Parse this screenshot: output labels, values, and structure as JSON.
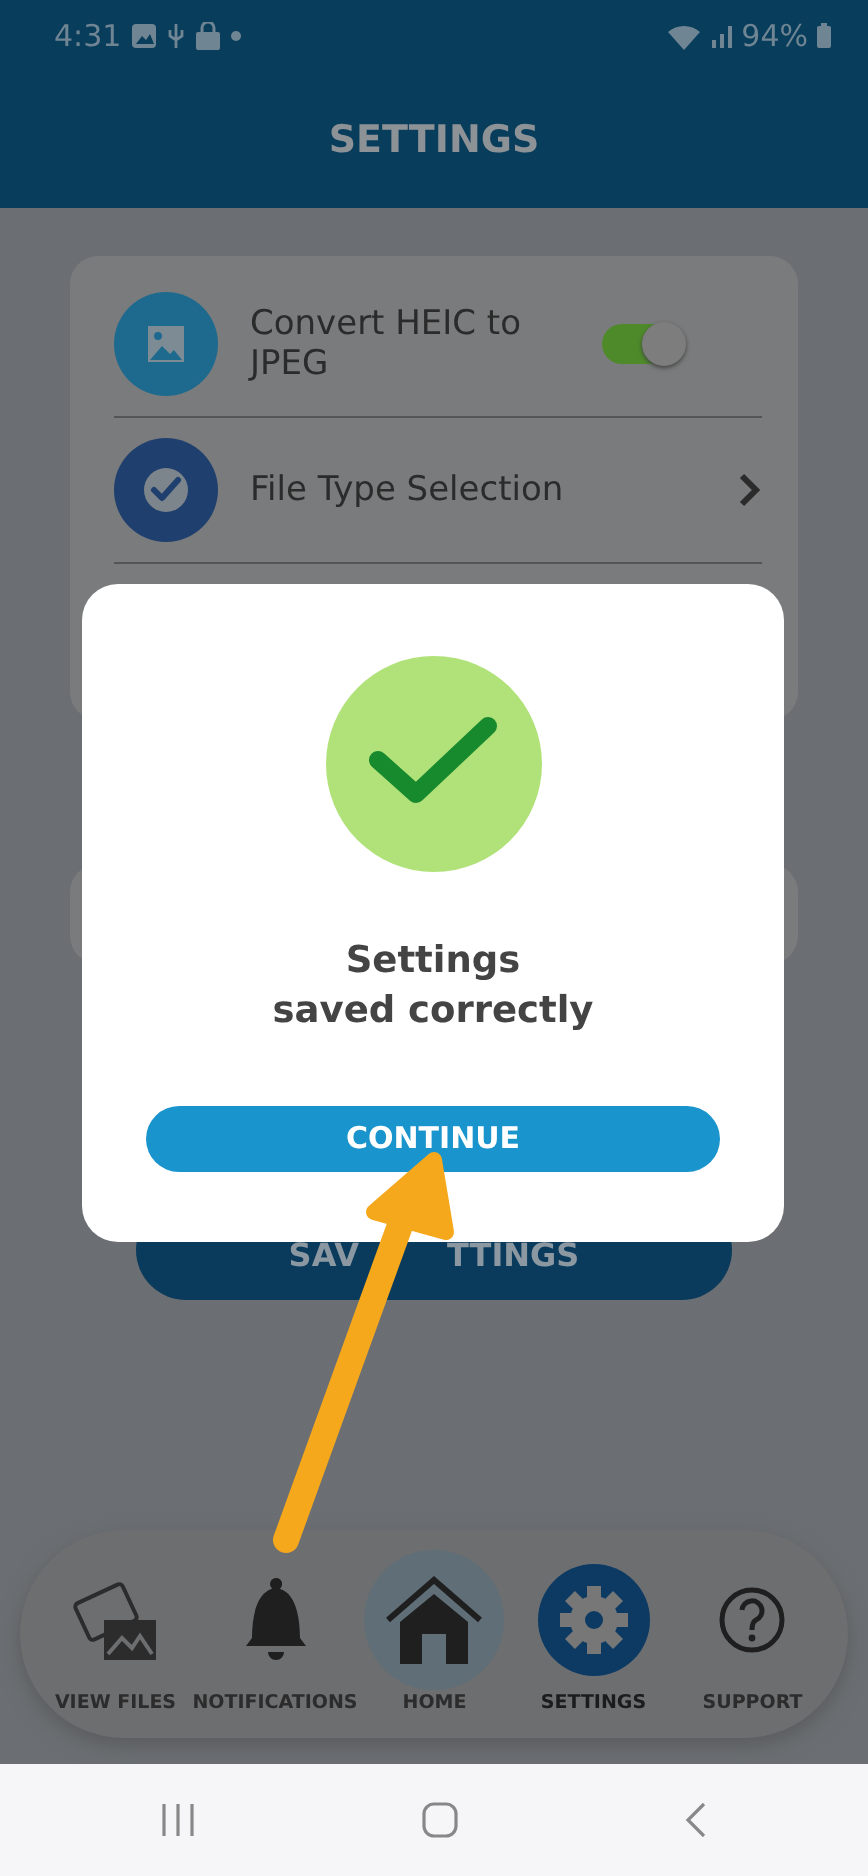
{
  "status_bar": {
    "time": "4:31",
    "battery": "94%"
  },
  "header": {
    "title": "SETTINGS"
  },
  "settings": [
    {
      "kind": "toggle",
      "label": "Convert HEIC to JPEG",
      "on": true
    },
    {
      "kind": "link",
      "label": "File Type Selection"
    }
  ],
  "save_button": {
    "label_parts": [
      "SAV",
      "TTINGS"
    ]
  },
  "dialog": {
    "message": "Settings\nsaved correctly",
    "button": "CONTINUE"
  },
  "bottom_nav": [
    {
      "kind": "files",
      "label": "VIEW FILES",
      "selected": false
    },
    {
      "kind": "bell",
      "label": "NOTIFICATIONS",
      "selected": false
    },
    {
      "kind": "home",
      "label": "HOME",
      "selected": false
    },
    {
      "kind": "gear",
      "label": "SETTINGS",
      "selected": true
    },
    {
      "kind": "help",
      "label": "SUPPORT",
      "selected": false
    }
  ]
}
